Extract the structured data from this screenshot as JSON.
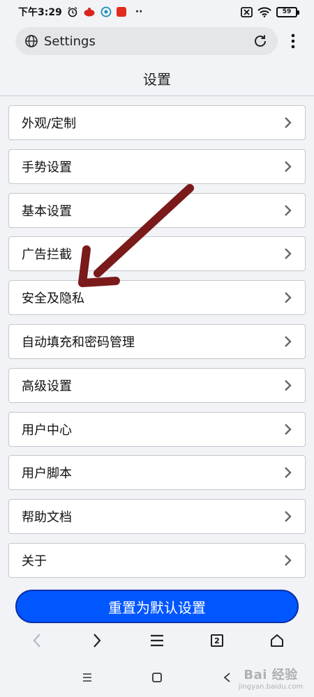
{
  "status_bar": {
    "time": "下午3:29",
    "dots": "··",
    "battery": "59",
    "icons": [
      "alarm-icon",
      "app-red-icon",
      "app-teal-icon",
      "app-red-square-icon",
      "sim-off-icon",
      "wifi-icon",
      "battery-icon"
    ]
  },
  "address_bar": {
    "url_text": "Settings",
    "icons": [
      "globe-icon",
      "reload-icon",
      "more-vert-icon"
    ]
  },
  "page": {
    "title": "设置"
  },
  "settings": {
    "items": [
      {
        "label": "外观/定制"
      },
      {
        "label": "手势设置"
      },
      {
        "label": "基本设置"
      },
      {
        "label": "广告拦截"
      },
      {
        "label": "安全及隐私"
      },
      {
        "label": "自动填充和密码管理"
      },
      {
        "label": "高级设置"
      },
      {
        "label": "用户中心"
      },
      {
        "label": "用户脚本"
      },
      {
        "label": "帮助文档"
      },
      {
        "label": "关于"
      }
    ]
  },
  "reset_button": {
    "label": "重置为默认设置"
  },
  "toolbar": {
    "tab_count": "2",
    "icons": [
      "back-icon",
      "forward-icon",
      "menu-icon",
      "tabs-icon",
      "home-icon"
    ]
  },
  "system_nav": {
    "icons": [
      "recents-icon",
      "home-square-icon",
      "back-triangle-icon"
    ]
  },
  "watermark": {
    "logo": "Bai 经验",
    "sub": "jingyan.baidu.com"
  },
  "colors": {
    "accent": "#0057ff",
    "background": "#f1f3f6",
    "annotation_arrow": "#7a1a1a"
  }
}
